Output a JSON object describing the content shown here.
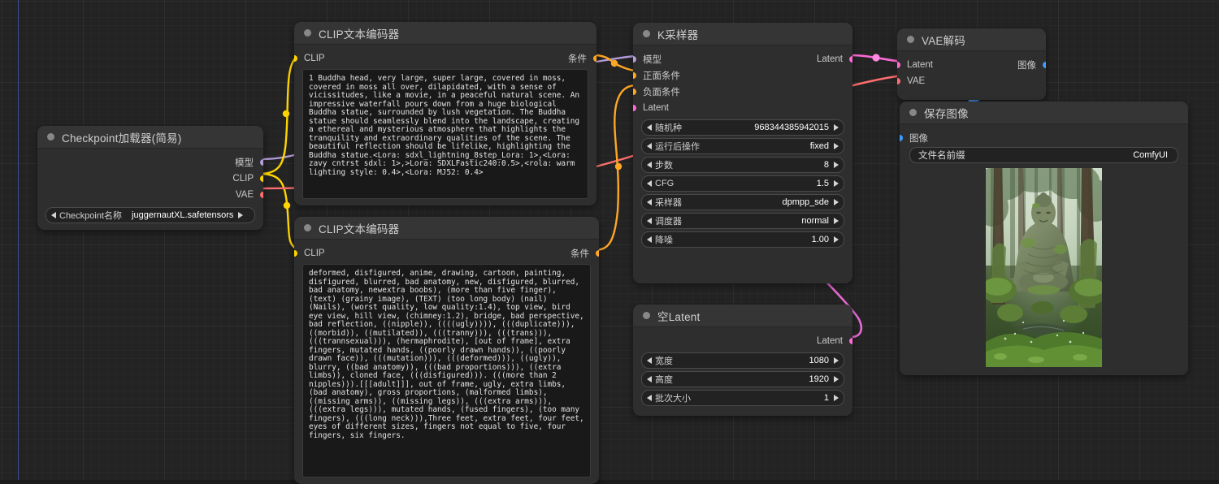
{
  "canvas": {
    "background_color": "#232323",
    "ruler_color": "#3f4f9e"
  },
  "link_colors": {
    "model": "#b39ddb",
    "clip": "#ffd500",
    "vae": "#ff6e6e",
    "conditioning": "#ffa726",
    "latent": "#ff6ad5",
    "image": "#3d9bff"
  },
  "nodes": {
    "checkpoint_loader": {
      "title": "Checkpoint加载器(简易)",
      "outputs": [
        {
          "label": "模型",
          "color": "#b39ddb"
        },
        {
          "label": "CLIP",
          "color": "#ffd500"
        },
        {
          "label": "VAE",
          "color": "#ff6e6e"
        }
      ],
      "widgets": [
        {
          "name": "Checkpoint名称",
          "value": "juggernautXL.safetensors"
        }
      ]
    },
    "clip_positive": {
      "title": "CLIP文本编码器",
      "inputs": [
        {
          "label": "CLIP",
          "color": "#ffd500"
        }
      ],
      "outputs": [
        {
          "label": "条件",
          "color": "#ffa726"
        }
      ],
      "text": "1 Buddha head, very large, super large, covered in moss, covered in moss all over, dilapidated, with a sense of vicissitudes, like a movie, in a peaceful natural scene. An impressive waterfall pours down from a huge biological Buddha statue, surrounded by lush vegetation. The Buddha statue should seamlessly blend into the landscape, creating a ethereal and mysterious atmosphere that highlights the tranquility and extraordinary qualities of the scene. The beautiful reflection should be lifelike, highlighting the Buddha statue.<Lora: sdxl_lightning_8step_Lora: 1>,<Lora: zavy cntrst sdxl: 1>,>Lora: SDXLFastic240:0.5>,<rola: warm lighting style: 0.4>,<Lora: MJ52: 0.4>"
    },
    "clip_negative": {
      "title": "CLIP文本编码器",
      "inputs": [
        {
          "label": "CLIP",
          "color": "#ffd500"
        }
      ],
      "outputs": [
        {
          "label": "条件",
          "color": "#ffa726"
        }
      ],
      "text": "deformed, disfigured, anime, drawing, cartoon, painting, disfigured, blurred, bad anatomy, new, disfigured, blurred, bad anatomy, newextra boobs), (more than five finger), (text) (grainy image), (TEXT) (too long body) (nail) (Nails), (worst quality, low quality:1.4), top view, bird eye view, hill view, (chimney:1.2), bridge, bad perspective, bad reflection, ((nipple)), ((((ugly)))), (((duplicate))), ((morbid)), ((mutilated)), (((tranny))), (((trans))), (((trannsexual))), (hermaphrodite), [out of frame], extra fingers, mutated hands, ((poorly drawn hands)), ((poorly drawn face)), (((mutation))), (((deformed))), ((ugly)), blurry, ((bad anatomy)), (((bad proportions))), ((extra limbs)), cloned face, (((disfigured))). (((more than 2 nipples))).[[[adult]]], out of frame, ugly, extra limbs, (bad anatomy), gross proportions, (malformed limbs), ((missing arms)), ((missing legs)), (((extra arms))), (((extra legs))), mutated hands, (fused fingers), (too many fingers), (((long neck))),Three feet, extra feet, four feet, eyes of different sizes, fingers not equal to five, four fingers, six fingers."
    },
    "ksampler": {
      "title": "K采样器",
      "inputs": [
        {
          "label": "模型",
          "color": "#b39ddb"
        },
        {
          "label": "正面条件",
          "color": "#ffa726"
        },
        {
          "label": "负面条件",
          "color": "#ffa726"
        },
        {
          "label": "Latent",
          "color": "#ff6ad5"
        }
      ],
      "outputs": [
        {
          "label": "Latent",
          "color": "#ff6ad5"
        }
      ],
      "widgets": [
        {
          "name": "随机种",
          "value": "968344385942015"
        },
        {
          "name": "运行后操作",
          "value": "fixed"
        },
        {
          "name": "步数",
          "value": "8"
        },
        {
          "name": "CFG",
          "value": "1.5"
        },
        {
          "name": "采样器",
          "value": "dpmpp_sde"
        },
        {
          "name": "调度器",
          "value": "normal"
        },
        {
          "name": "降噪",
          "value": "1.00"
        }
      ]
    },
    "empty_latent": {
      "title": "空Latent",
      "outputs": [
        {
          "label": "Latent",
          "color": "#ff6ad5"
        }
      ],
      "widgets": [
        {
          "name": "宽度",
          "value": "1080"
        },
        {
          "name": "高度",
          "value": "1920"
        },
        {
          "name": "批次大小",
          "value": "1"
        }
      ]
    },
    "vae_decode": {
      "title": "VAE解码",
      "inputs": [
        {
          "label": "Latent",
          "color": "#ff6ad5"
        },
        {
          "label": "VAE",
          "color": "#ff6e6e"
        }
      ],
      "outputs": [
        {
          "label": "图像",
          "color": "#3d9bff"
        }
      ]
    },
    "save_image": {
      "title": "保存图像",
      "inputs": [
        {
          "label": "图像",
          "color": "#3d9bff"
        }
      ],
      "widgets": [
        {
          "name": "文件名前缀",
          "value": "ComfyUI"
        }
      ],
      "preview_alt": "moss-covered Buddha statue sitting in a green forest"
    }
  }
}
